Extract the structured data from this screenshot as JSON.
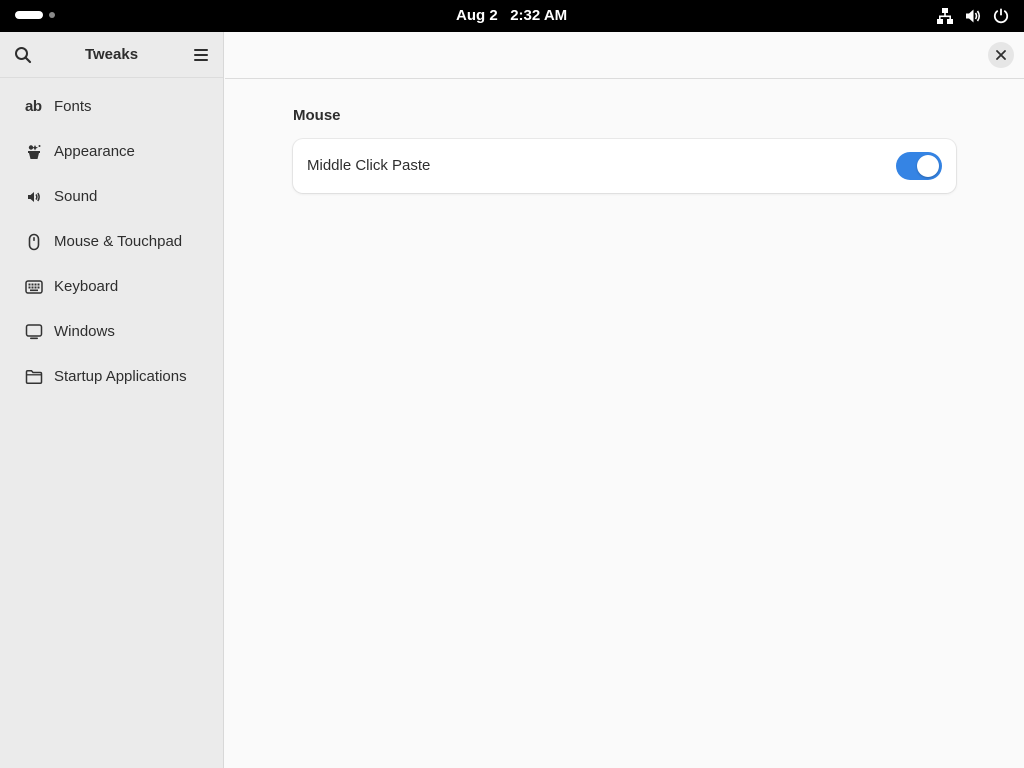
{
  "topbar": {
    "date": "Aug 2",
    "time": "2:32 AM",
    "icons": [
      "network-icon",
      "volume-icon",
      "power-icon"
    ]
  },
  "sidebar": {
    "title": "Tweaks",
    "items": [
      {
        "label": "Fonts",
        "icon": "fonts-icon"
      },
      {
        "label": "Appearance",
        "icon": "appearance-icon"
      },
      {
        "label": "Sound",
        "icon": "sound-icon"
      },
      {
        "label": "Mouse & Touchpad",
        "icon": "mouse-icon"
      },
      {
        "label": "Keyboard",
        "icon": "keyboard-icon"
      },
      {
        "label": "Windows",
        "icon": "windows-icon"
      },
      {
        "label": "Startup Applications",
        "icon": "folder-icon"
      }
    ]
  },
  "main": {
    "section_title": "Mouse",
    "settings": [
      {
        "label": "Middle Click Paste",
        "enabled": true
      }
    ]
  },
  "colors": {
    "accent": "#3584e4",
    "topbar": "#000000",
    "sidebar_bg": "#ebebeb",
    "content_bg": "#fafafa"
  }
}
